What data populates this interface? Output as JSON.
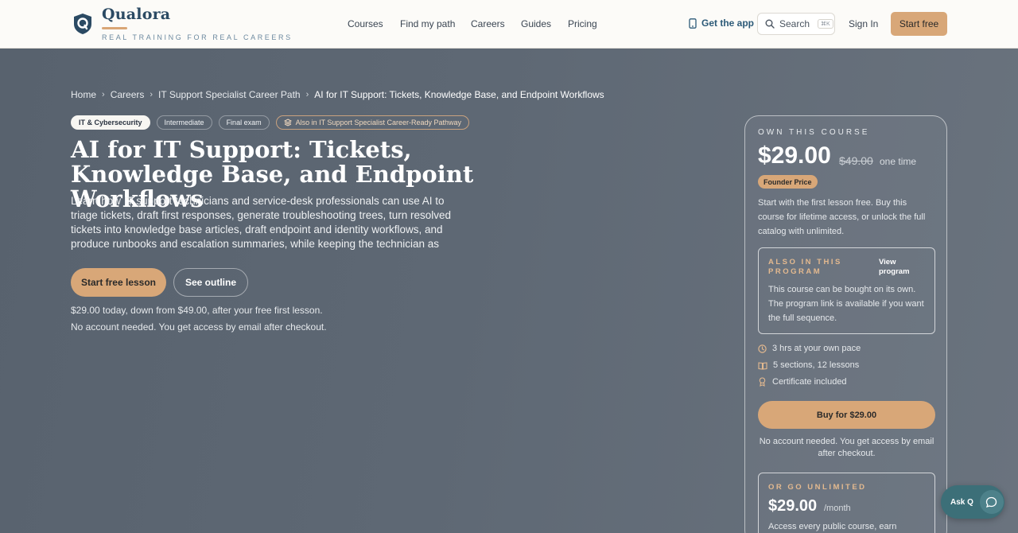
{
  "header": {
    "brand_name": "Qualora",
    "brand_tagline": "REAL TRAINING FOR REAL CAREERS",
    "nav": [
      "Courses",
      "Find my path",
      "Careers",
      "Guides",
      "Pricing"
    ],
    "get_app": "Get the app",
    "search_label": "Search",
    "search_shortcut": "⌘K",
    "sign_in": "Sign In",
    "start_free": "Start free"
  },
  "breadcrumb": [
    "Home",
    "Careers",
    "IT Support Specialist Career Path",
    "AI for IT Support: Tickets, Knowledge Base, and Endpoint Workflows"
  ],
  "tags": {
    "category": "IT & Cybersecurity",
    "level": "Intermediate",
    "exam": "Final exam",
    "pathway": "Also in IT Support Specialist Career-Ready Pathway"
  },
  "course": {
    "title": "AI for IT Support: Tickets, Knowledge Base, and Endpoint Workflows",
    "description": "Learn how IT support technicians and service-desk professionals can use AI to triage tickets, draft first responses, generate troubleshooting trees, turn resolved tickets into knowledge base articles, draft endpoint and identity workflows, and produce runbooks and escalation summaries, while keeping the technician as",
    "primary_cta": "Start free lesson",
    "secondary_cta": "See outline",
    "price_note": "$29.00 today, down from $49.00, after your free first lesson.",
    "account_note": "No account needed. You get access by email after checkout."
  },
  "purchase_card": {
    "own_label": "OWN THIS COURSE",
    "price": "$29.00",
    "old_price": "$49.00",
    "price_suffix": "one time",
    "badge": "Founder Price",
    "description": "Start with the first lesson free. Buy this course for lifetime access, or unlock the full catalog with unlimited.",
    "program": {
      "label": "ALSO IN THIS PROGRAM",
      "view_link": "View program",
      "text": "This course can be bought on its own. The program link is available if you want the full sequence."
    },
    "features": [
      "3 hrs at your own pace",
      "5 sections, 12 lessons",
      "Certificate included"
    ],
    "buy_button": "Buy for $29.00",
    "note": "No account needed. You get access by email after checkout.",
    "unlimited": {
      "label": "OR GO UNLIMITED",
      "price": "$29.00",
      "per": "/month",
      "text": "Access every public course, earn"
    }
  },
  "assistant": {
    "label": "Ask Q"
  },
  "colors": {
    "accent": "#d8a778",
    "brand": "#2b4a63",
    "hero_bg": "#5b6672"
  }
}
